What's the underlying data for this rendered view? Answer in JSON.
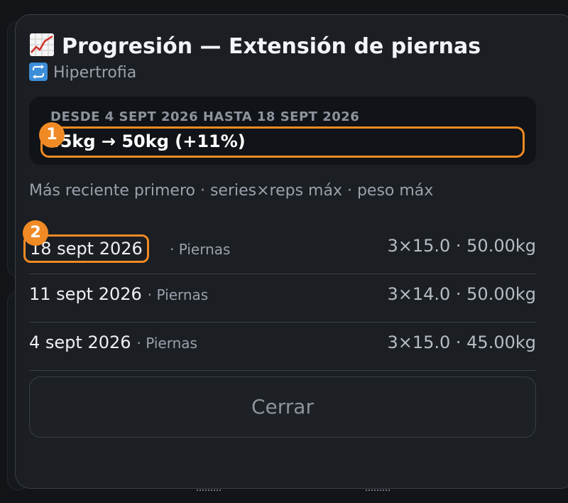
{
  "background": {
    "top_hint": ""
  },
  "modal": {
    "title": "Progresión — Extensión de piernas",
    "title_icon": "chart-increasing-icon",
    "subtitle": "Hipertrofia",
    "subtitle_icon": "repeat-arrows-icon",
    "summary": {
      "range": "DESDE 4 SEPT 2026 HASTA 18 SEPT 2026",
      "delta": "45kg → 50kg (+11%)"
    },
    "hint": "Más reciente primero · series×reps máx · peso máx",
    "rows": [
      {
        "date": "18 sept 2026",
        "meta": "· Piernas",
        "value": "3×15.0 · 50.00kg"
      },
      {
        "date": "11 sept 2026",
        "meta": "· Piernas",
        "value": "3×14.0 · 50.00kg"
      },
      {
        "date": "4 sept 2026",
        "meta": "· Piernas",
        "value": "3×15.0 · 45.00kg"
      }
    ],
    "close_label": "Cerrar"
  },
  "annotations": {
    "badge_1": "1",
    "badge_2": "2"
  },
  "colors": {
    "accent": "#f08a24",
    "surface": "#1b1e23",
    "border": "#3a3f47"
  }
}
